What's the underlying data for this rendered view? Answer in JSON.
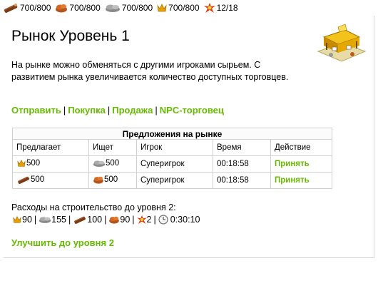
{
  "resources": {
    "wood": "700/800",
    "stone": "700/800",
    "ore": "700/800",
    "gold": "700/800",
    "workers": "12/18"
  },
  "page": {
    "title": "Рынок Уровень 1",
    "description": "На рынке можно обменяться с другими игроками сырьем. С развитием рынка увеличивается количество доступных торговцев."
  },
  "nav": {
    "send": "Отправить",
    "buy": "Покупка",
    "sell": "Продажа",
    "npc": "NPC-торговец",
    "sep": "|"
  },
  "offers": {
    "caption": "Предложения на рынке",
    "headers": [
      "Предлагает",
      "Ищет",
      "Игрок",
      "Время",
      "Действие"
    ],
    "rows": [
      {
        "offer_icon": "crown-gold-icon",
        "offer": "500",
        "want_icon": "stone-icon",
        "want": "500",
        "player": "Суперигрок",
        "time": "00:18:58",
        "action": "Принять"
      },
      {
        "offer_icon": "wood-icon",
        "offer": "500",
        "want_icon": "ore-icon",
        "want": "500",
        "player": "Суперигрок",
        "time": "00:18:58",
        "action": "Принять"
      }
    ]
  },
  "costs": {
    "label": "Расходы на строительство до уровня 2:",
    "gold": "90",
    "stone": "155",
    "wood": "100",
    "ore": "90",
    "workers": "2",
    "time": "0:30:10",
    "sep": "|"
  },
  "upgrade": {
    "label": "Улучшить до уровня 2"
  },
  "colors": {
    "link": "#66bb00",
    "border": "#d0d0d0"
  }
}
